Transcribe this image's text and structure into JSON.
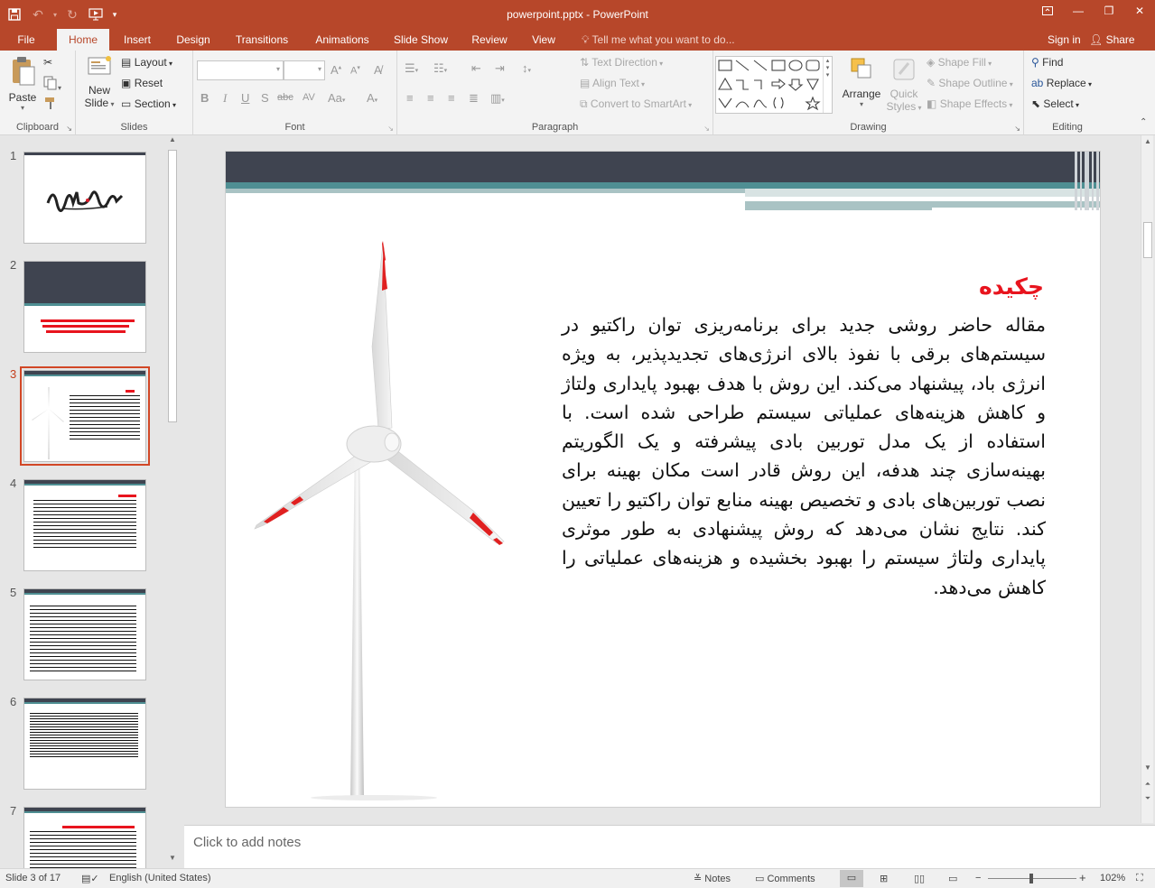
{
  "window": {
    "title": "powerpoint.pptx - PowerPoint"
  },
  "tabs": [
    {
      "label": "File"
    },
    {
      "label": "Home",
      "active": true
    },
    {
      "label": "Insert"
    },
    {
      "label": "Design"
    },
    {
      "label": "Transitions"
    },
    {
      "label": "Animations"
    },
    {
      "label": "Slide Show"
    },
    {
      "label": "Review"
    },
    {
      "label": "View"
    }
  ],
  "tell_me": "Tell me what you want to do...",
  "account": {
    "sign_in": "Sign in",
    "share": "Share"
  },
  "ribbon": {
    "clipboard": {
      "label": "Clipboard",
      "paste": "Paste"
    },
    "slides": {
      "label": "Slides",
      "new_slide_1": "New",
      "new_slide_2": "Slide",
      "layout": "Layout",
      "reset": "Reset",
      "section": "Section"
    },
    "font": {
      "label": "Font"
    },
    "paragraph": {
      "label": "Paragraph",
      "text_direction": "Text Direction",
      "align_text": "Align Text",
      "convert_smartart": "Convert to SmartArt"
    },
    "drawing": {
      "label": "Drawing",
      "arrange": "Arrange",
      "quick_styles_1": "Quick",
      "quick_styles_2": "Styles",
      "shape_fill": "Shape Fill",
      "shape_outline": "Shape Outline",
      "shape_effects": "Shape Effects"
    },
    "editing": {
      "label": "Editing",
      "find": "Find",
      "replace": "Replace",
      "select": "Select"
    }
  },
  "thumbnails": [
    {
      "num": "1"
    },
    {
      "num": "2"
    },
    {
      "num": "3",
      "selected": true
    },
    {
      "num": "4"
    },
    {
      "num": "5"
    },
    {
      "num": "6"
    },
    {
      "num": "7"
    }
  ],
  "slide": {
    "title": "چکیده",
    "body": "مقاله حاضر روشی جدید برای برنامه‌ریزی توان راکتیو در سیستم‌های برقی با نفوذ بالای انرژی‌های تجدیدپذیر، به ویژه انرژی باد، پیشنهاد می‌کند. این روش با هدف بهبود پایداری ولتاژ و کاهش هزینه‌های عملیاتی سیستم طراحی شده است. با استفاده از یک مدل توربین بادی پیشرفته و یک الگوریتم بهینه‌سازی چند هدفه، این روش قادر است مکان بهینه برای نصب توربین‌های بادی و تخصیص بهینه منابع توان راکتیو را تعیین کند. نتایج نشان می‌دهد که روش پیشنهادی به طور موثری پایداری ولتاژ سیستم را بهبود بخشیده و هزینه‌های عملیاتی را کاهش می‌دهد.",
    "title_color": "#e8141e"
  },
  "notes": {
    "placeholder": "Click to add notes"
  },
  "status": {
    "slide_count": "Slide 3 of 17",
    "language": "English (United States)",
    "notes": "Notes",
    "comments": "Comments",
    "zoom": "102%"
  },
  "colors": {
    "accent": "#b7472a",
    "selection": "#d24726"
  }
}
